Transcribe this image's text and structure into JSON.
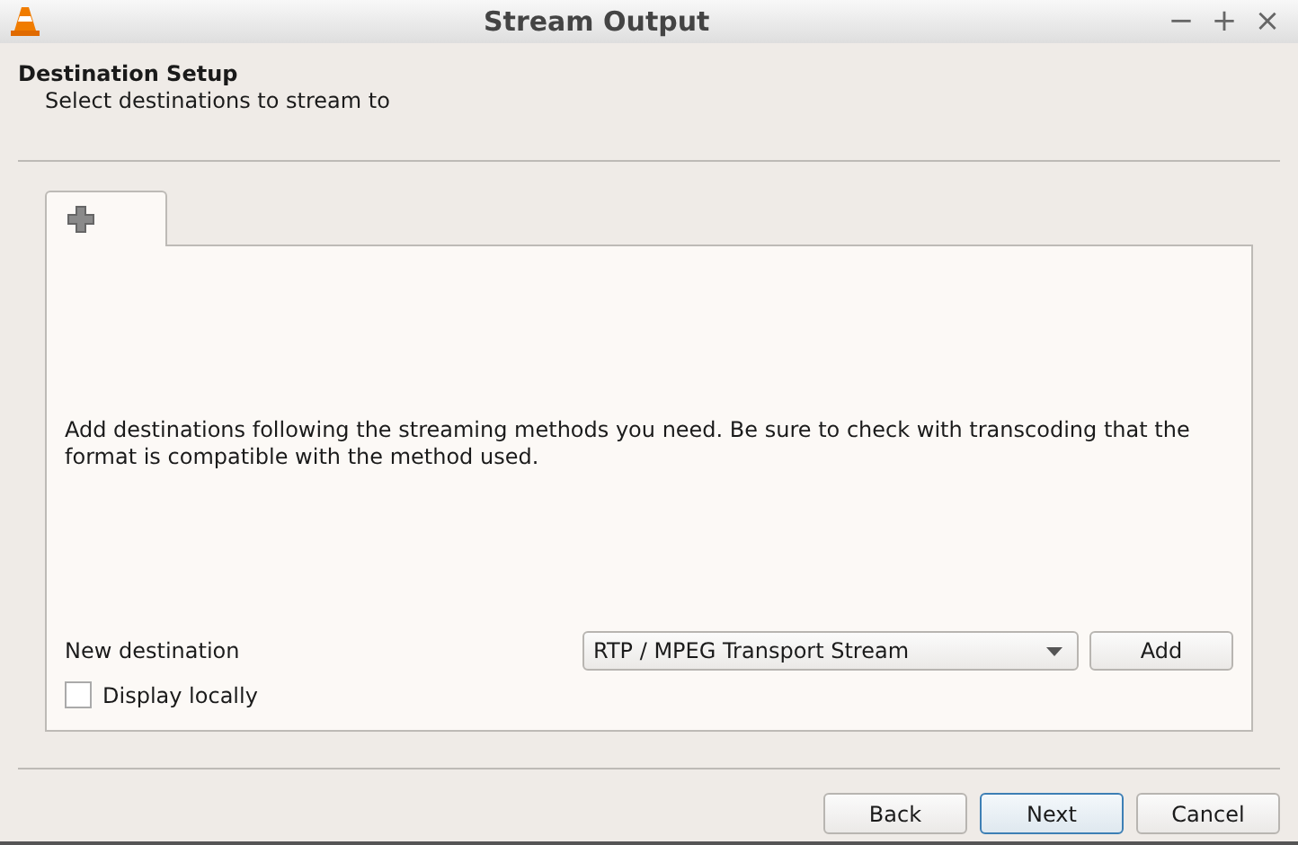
{
  "window": {
    "title": "Stream Output",
    "controls": [
      "−",
      "+",
      "×"
    ]
  },
  "header": {
    "title": "Destination Setup",
    "subtitle": "Select destinations to stream to"
  },
  "tabs": [
    {
      "selected": true
    }
  ],
  "panel": {
    "description": "Add destinations following the streaming methods you need. Be sure to check with transcoding that the format is compatible with the method used.",
    "new_destination_label": "New destination",
    "destination_select": {
      "value": "RTP / MPEG Transport Stream"
    },
    "add_button": "Add",
    "display_locally": {
      "label": "Display locally",
      "checked": false
    }
  },
  "buttons": [
    {
      "label": "Back",
      "default": false
    },
    {
      "label": "Next",
      "default": true
    },
    {
      "label": "Cancel",
      "default": false
    }
  ]
}
